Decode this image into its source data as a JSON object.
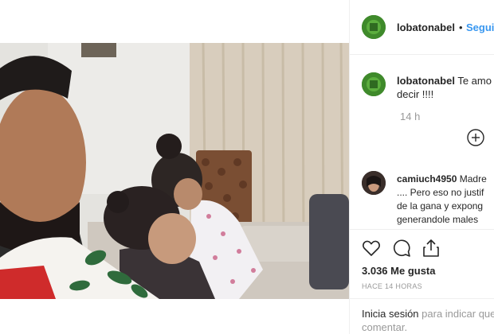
{
  "post": {
    "username": "lobatonabel",
    "separator": "•",
    "follow_label": "Seguir"
  },
  "caption": {
    "username": "lobatonabel",
    "text_line1": "Te amo",
    "text_line2": "decir !!!!",
    "time": "14 h"
  },
  "comment": {
    "username": "camiuch4950",
    "first_word": "Madre",
    "line2": ".... Pero eso no justif",
    "line3": "de la gana y expong",
    "line4": "generandole males"
  },
  "stats": {
    "likes": "3.036 Me gusta",
    "timestamp": "HACE 14 HORAS"
  },
  "login": {
    "link": "Inicia sesión",
    "text_rest": " para indicar que",
    "text_line2": "comentar."
  },
  "icons": {
    "like": "heart-outline-icon",
    "comment": "speech-bubble-icon",
    "share": "share-upload-icon",
    "caption_like": "add-circle-icon"
  }
}
